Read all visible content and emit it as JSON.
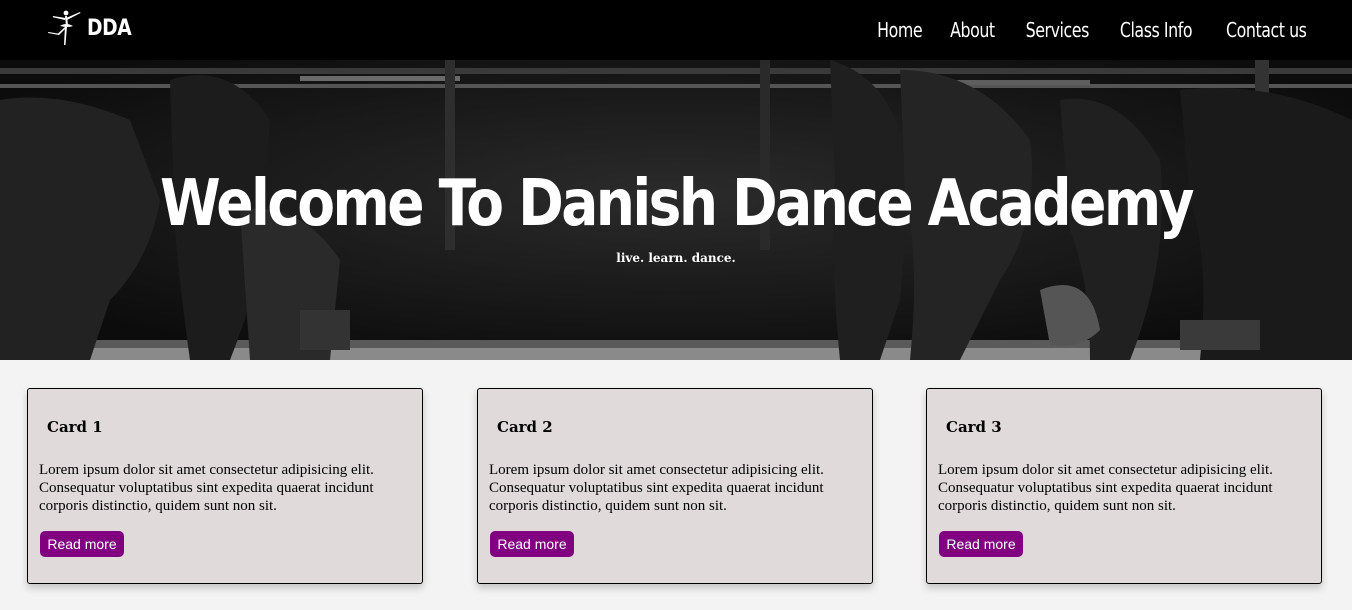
{
  "nav": {
    "brand": "DDA",
    "links": [
      "Home",
      "About",
      "Services",
      "Class Info",
      "Contact us"
    ]
  },
  "hero": {
    "title": "Welcome To Danish Dance Academy",
    "subtitle": "live. learn. dance."
  },
  "cards": [
    {
      "title": "Card 1",
      "text": "Lorem ipsum dolor sit amet consectetur adipisicing elit. Consequatur voluptatibus sint expedita quaerat incidunt corporis distinctio, quidem sunt non sit.",
      "button": "Read more"
    },
    {
      "title": "Card 2",
      "text": "Lorem ipsum dolor sit amet consectetur adipisicing elit. Consequatur voluptatibus sint expedita quaerat incidunt corporis distinctio, quidem sunt non sit.",
      "button": "Read more"
    },
    {
      "title": "Card 3",
      "text": "Lorem ipsum dolor sit amet consectetur adipisicing elit. Consequatur voluptatibus sint expedita quaerat incidunt corporis distinctio, quidem sunt non sit.",
      "button": "Read more"
    }
  ],
  "colors": {
    "nav_bg": "#000000",
    "button": "#800080",
    "card_bg": "#e0dadb",
    "page_bg": "#f3f3f3"
  },
  "icons": {
    "brand_logo": "ballerina-icon"
  }
}
